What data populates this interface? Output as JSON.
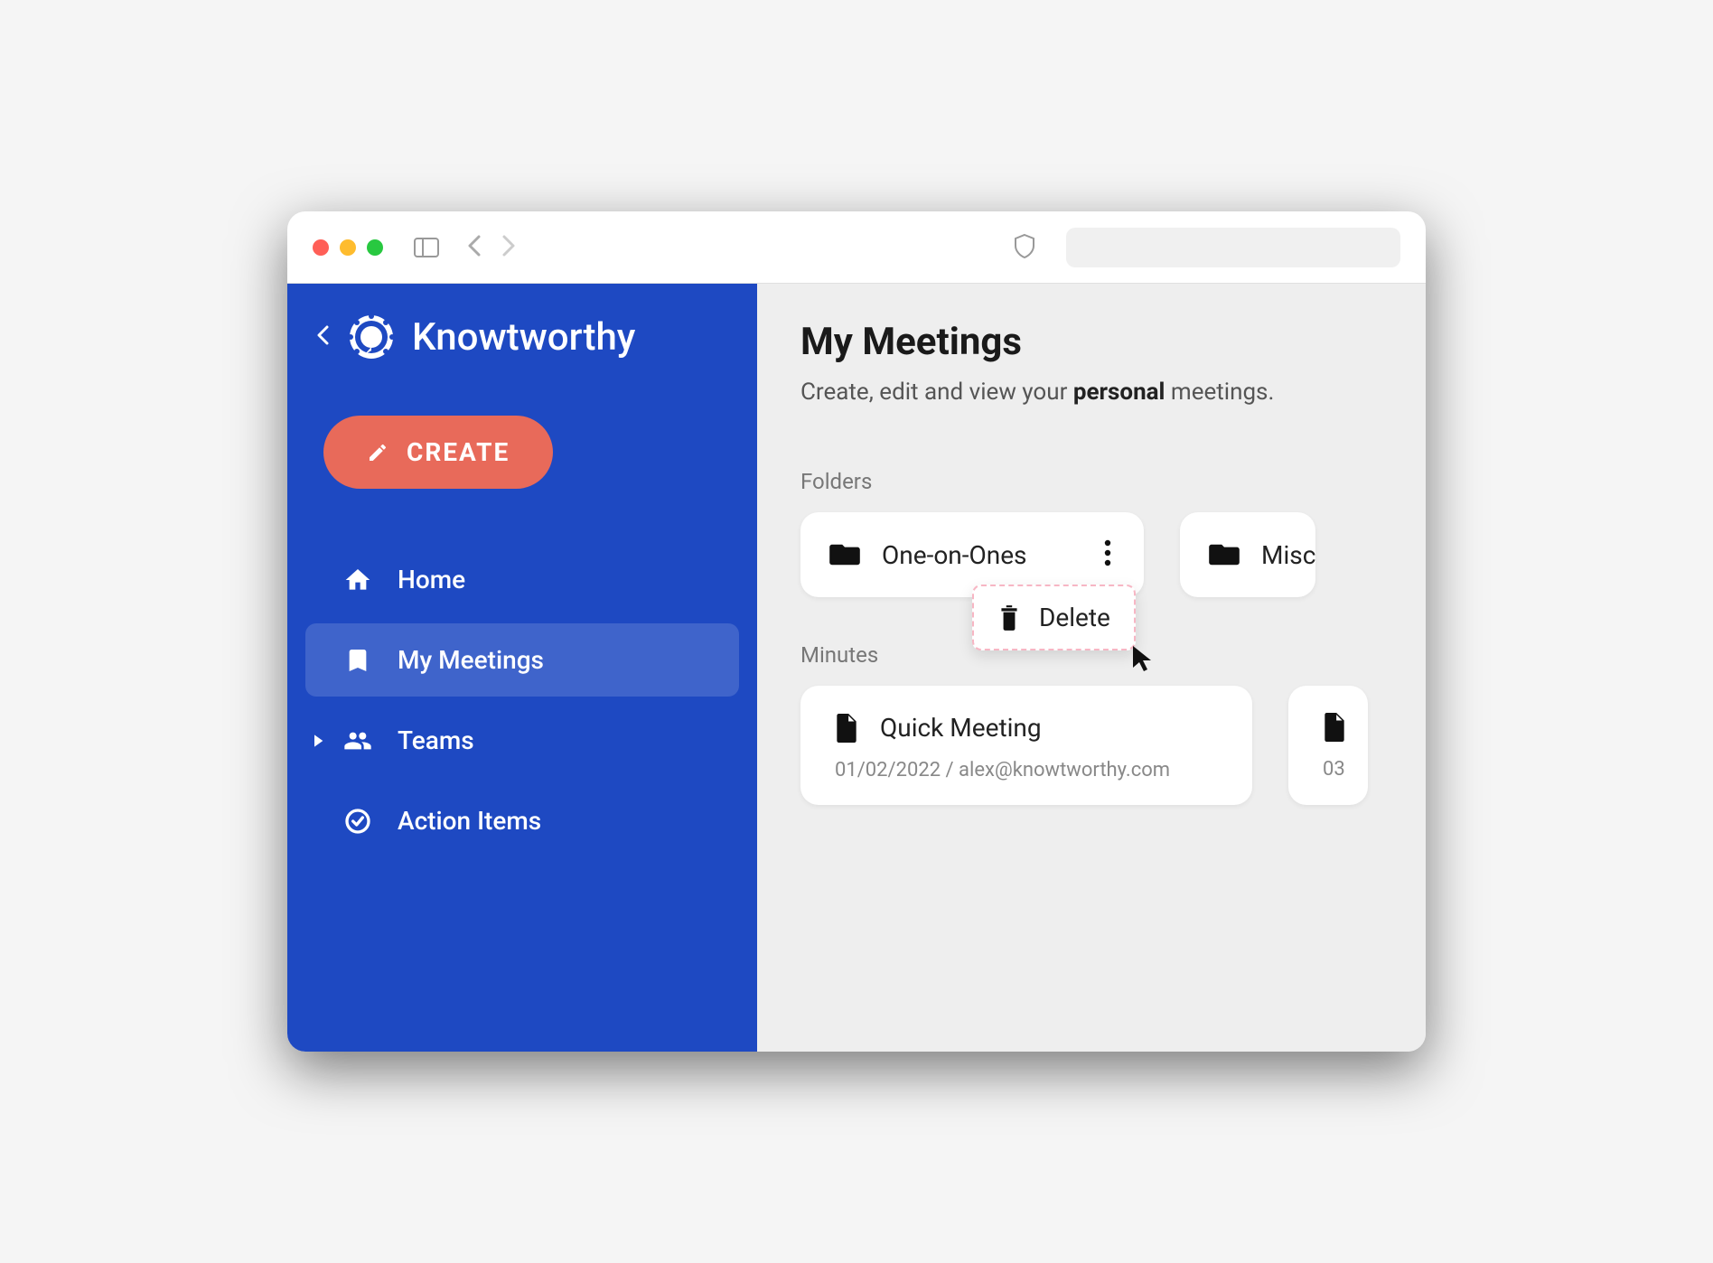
{
  "brand": {
    "name": "Knowtworthy"
  },
  "create_button": {
    "label": "CREATE"
  },
  "nav": {
    "home": "Home",
    "my_meetings": "My Meetings",
    "teams": "Teams",
    "action_items": "Action Items"
  },
  "main": {
    "title": "My Meetings",
    "subtitle_prefix": "Create, edit and view your ",
    "subtitle_bold": "personal",
    "subtitle_suffix": " meetings. "
  },
  "sections": {
    "folders_label": "Folders",
    "minutes_label": "Minutes"
  },
  "folders": [
    {
      "name": "One-on-Ones"
    },
    {
      "name": "Misc"
    }
  ],
  "dropdown": {
    "delete": "Delete"
  },
  "minutes": [
    {
      "title": "Quick Meeting",
      "meta": "01/02/2022 / alex@knowtworthy.com"
    },
    {
      "title": "",
      "meta": "03"
    }
  ]
}
